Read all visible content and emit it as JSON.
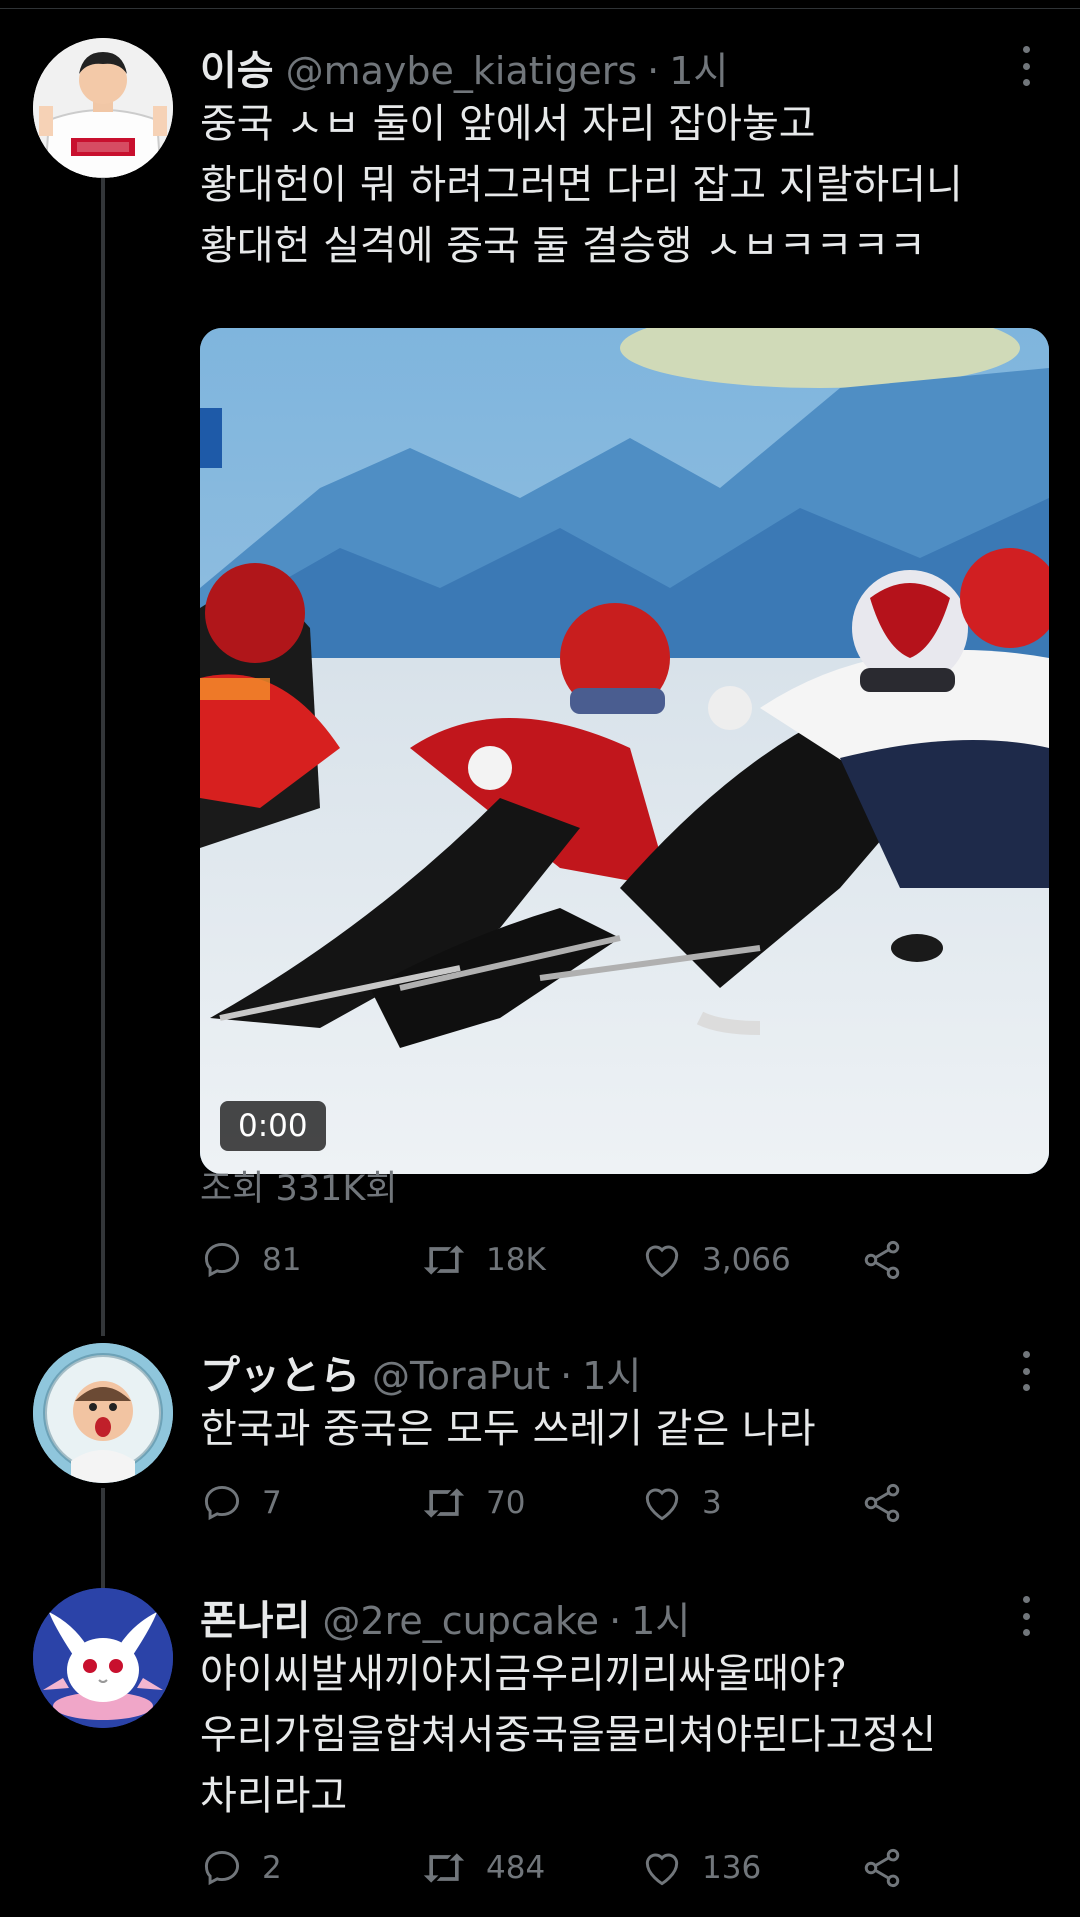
{
  "tweets": [
    {
      "name": "이승",
      "handle": "@maybe_kiatigers",
      "time": "1시",
      "lines": [
        "중국 ㅅㅂ 둘이 앞에서 자리 잡아놓고",
        "황대헌이 뭐 하려그러면 다리 잡고 지랄하더니",
        "황대헌 실격에 중국 둘 결승행 ㅅㅂㅋㅋㅋㅋ"
      ],
      "video_duration": "0:00",
      "views": "조회 331K회",
      "replies": "81",
      "retweets": "18K",
      "likes": "3,066"
    },
    {
      "name": "プッとら",
      "handle": "@ToraPut",
      "time": "1시",
      "lines": [
        "한국과 중국은 모두 쓰레기 같은 나라"
      ],
      "replies": "7",
      "retweets": "70",
      "likes": "3"
    },
    {
      "name": "폰나리",
      "handle": "@2re_cupcake",
      "time": "1시",
      "lines": [
        "야이씨발새끼야지금우리끼리싸울때야?",
        "우리가힘을합쳐서중국을물리쳐야된다고정신",
        "차리라고"
      ],
      "replies": "2",
      "retweets": "484",
      "likes": "136"
    }
  ],
  "separator": "·",
  "icons": [
    "reply-icon",
    "retweet-icon",
    "like-icon",
    "share-icon",
    "more-icon"
  ],
  "colors": {
    "background": "#000000",
    "text": "#e7e9ea",
    "muted": "#71767b"
  }
}
